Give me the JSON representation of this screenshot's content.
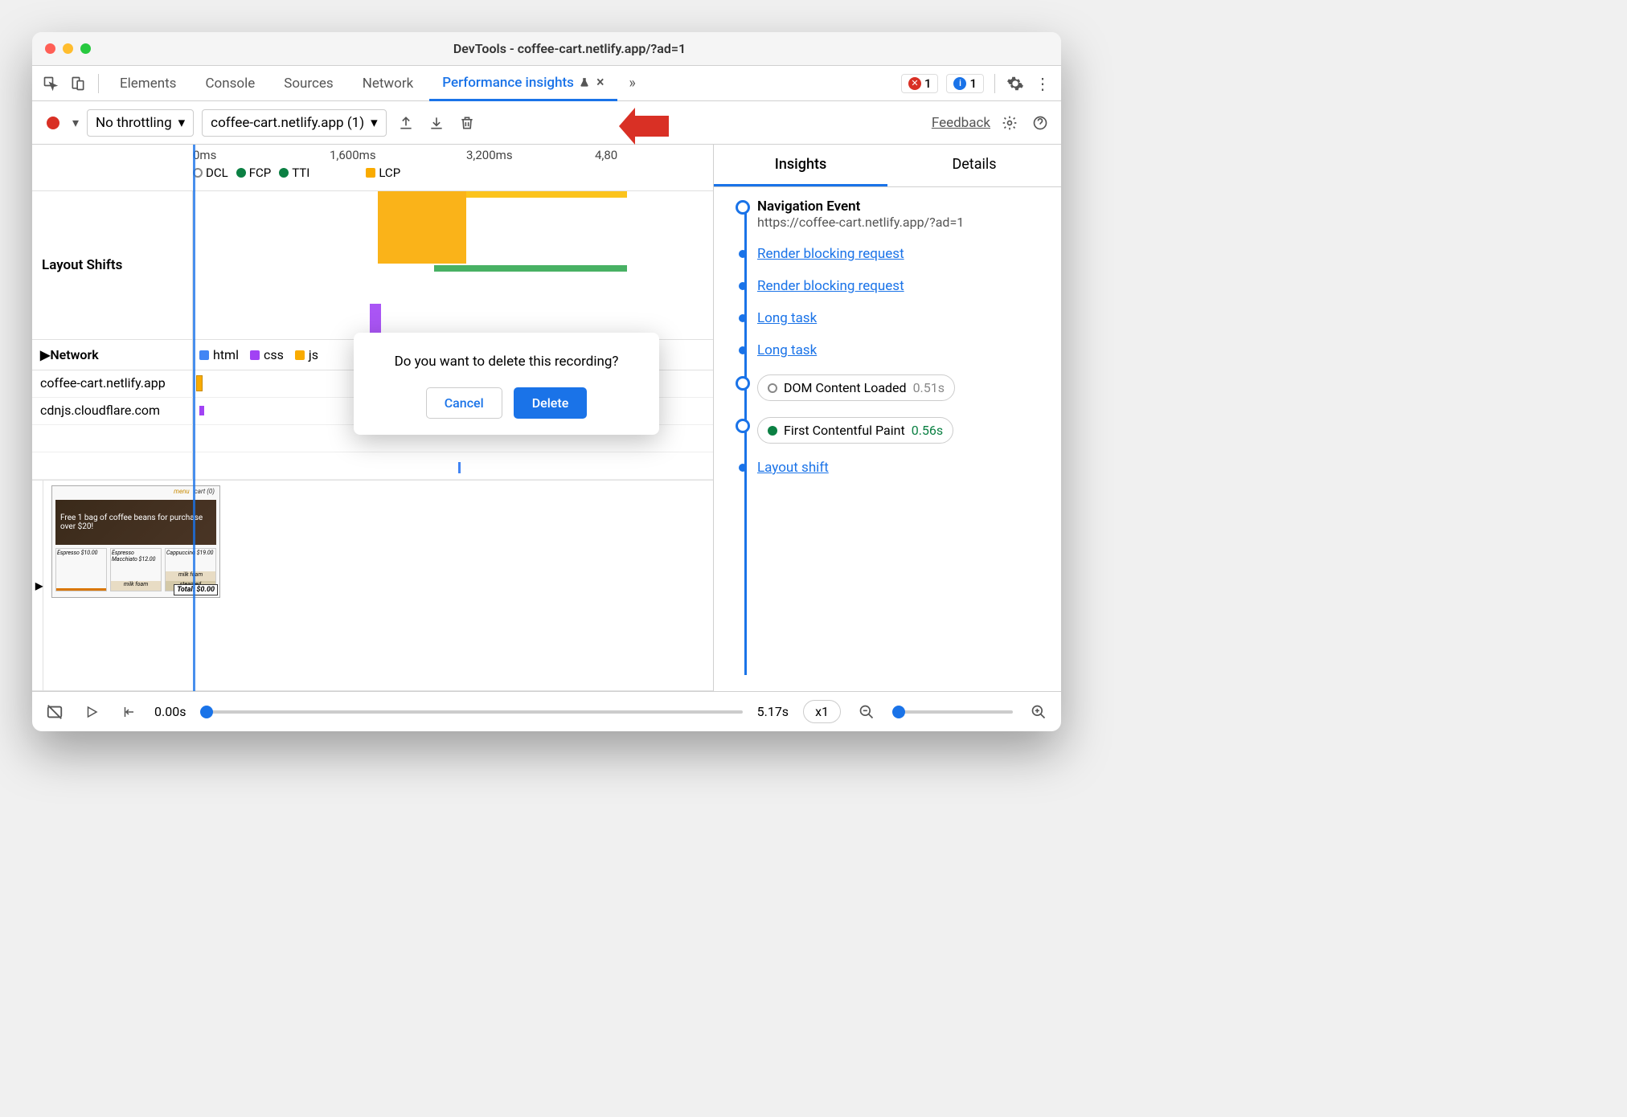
{
  "window": {
    "title": "DevTools - coffee-cart.netlify.app/?ad=1"
  },
  "tabs": {
    "elements": "Elements",
    "console": "Console",
    "sources": "Sources",
    "network": "Network",
    "performance_insights": "Performance insights"
  },
  "badges": {
    "errors": "1",
    "info": "1"
  },
  "toolbar": {
    "throttling": "No throttling",
    "recording": "coffee-cart.netlify.app (1)",
    "feedback": "Feedback"
  },
  "timeline": {
    "ticks": [
      "0ms",
      "1,600ms",
      "3,200ms",
      "4,80"
    ],
    "markers": {
      "dcl": "DCL",
      "fcp": "FCP",
      "tti": "TTI",
      "lcp": "LCP"
    }
  },
  "sections": {
    "layout_shifts": "Layout Shifts",
    "network": "Network",
    "renders": ""
  },
  "network_legend": {
    "html": "html",
    "css": "css",
    "js": "js"
  },
  "network_hosts": [
    "coffee-cart.netlify.app",
    "cdnjs.cloudflare.com"
  ],
  "thumbnail": {
    "banner": "Free 1 bag of coffee beans for purchase over $20!",
    "products": [
      "Espresso $10.00",
      "Espresso Macchiato $12.00",
      "Cappuccino $19.00"
    ],
    "milkfoam": "milk foam",
    "steamed": "steamed",
    "total": "Total: $0.00",
    "nav_menu": "menu",
    "nav_cart": "cart (0)"
  },
  "right": {
    "tabs": {
      "insights": "Insights",
      "details": "Details"
    },
    "nav_event": {
      "title": "Navigation Event",
      "url": "https://coffee-cart.netlify.app/?ad=1"
    },
    "render_block_1": "Render blocking request",
    "render_block_2": "Render blocking request",
    "long_task_1": "Long task",
    "long_task_2": "Long task",
    "dcl_chip": {
      "label": "DOM Content Loaded",
      "time": "0.51s"
    },
    "fcp_chip": {
      "label": "First Contentful Paint",
      "time": "0.56s"
    },
    "layout_shift": "Layout shift"
  },
  "footer": {
    "start": "0.00s",
    "end": "5.17s",
    "zoom": "x1"
  },
  "modal": {
    "text": "Do you want to delete this recording?",
    "cancel": "Cancel",
    "delete": "Delete"
  }
}
